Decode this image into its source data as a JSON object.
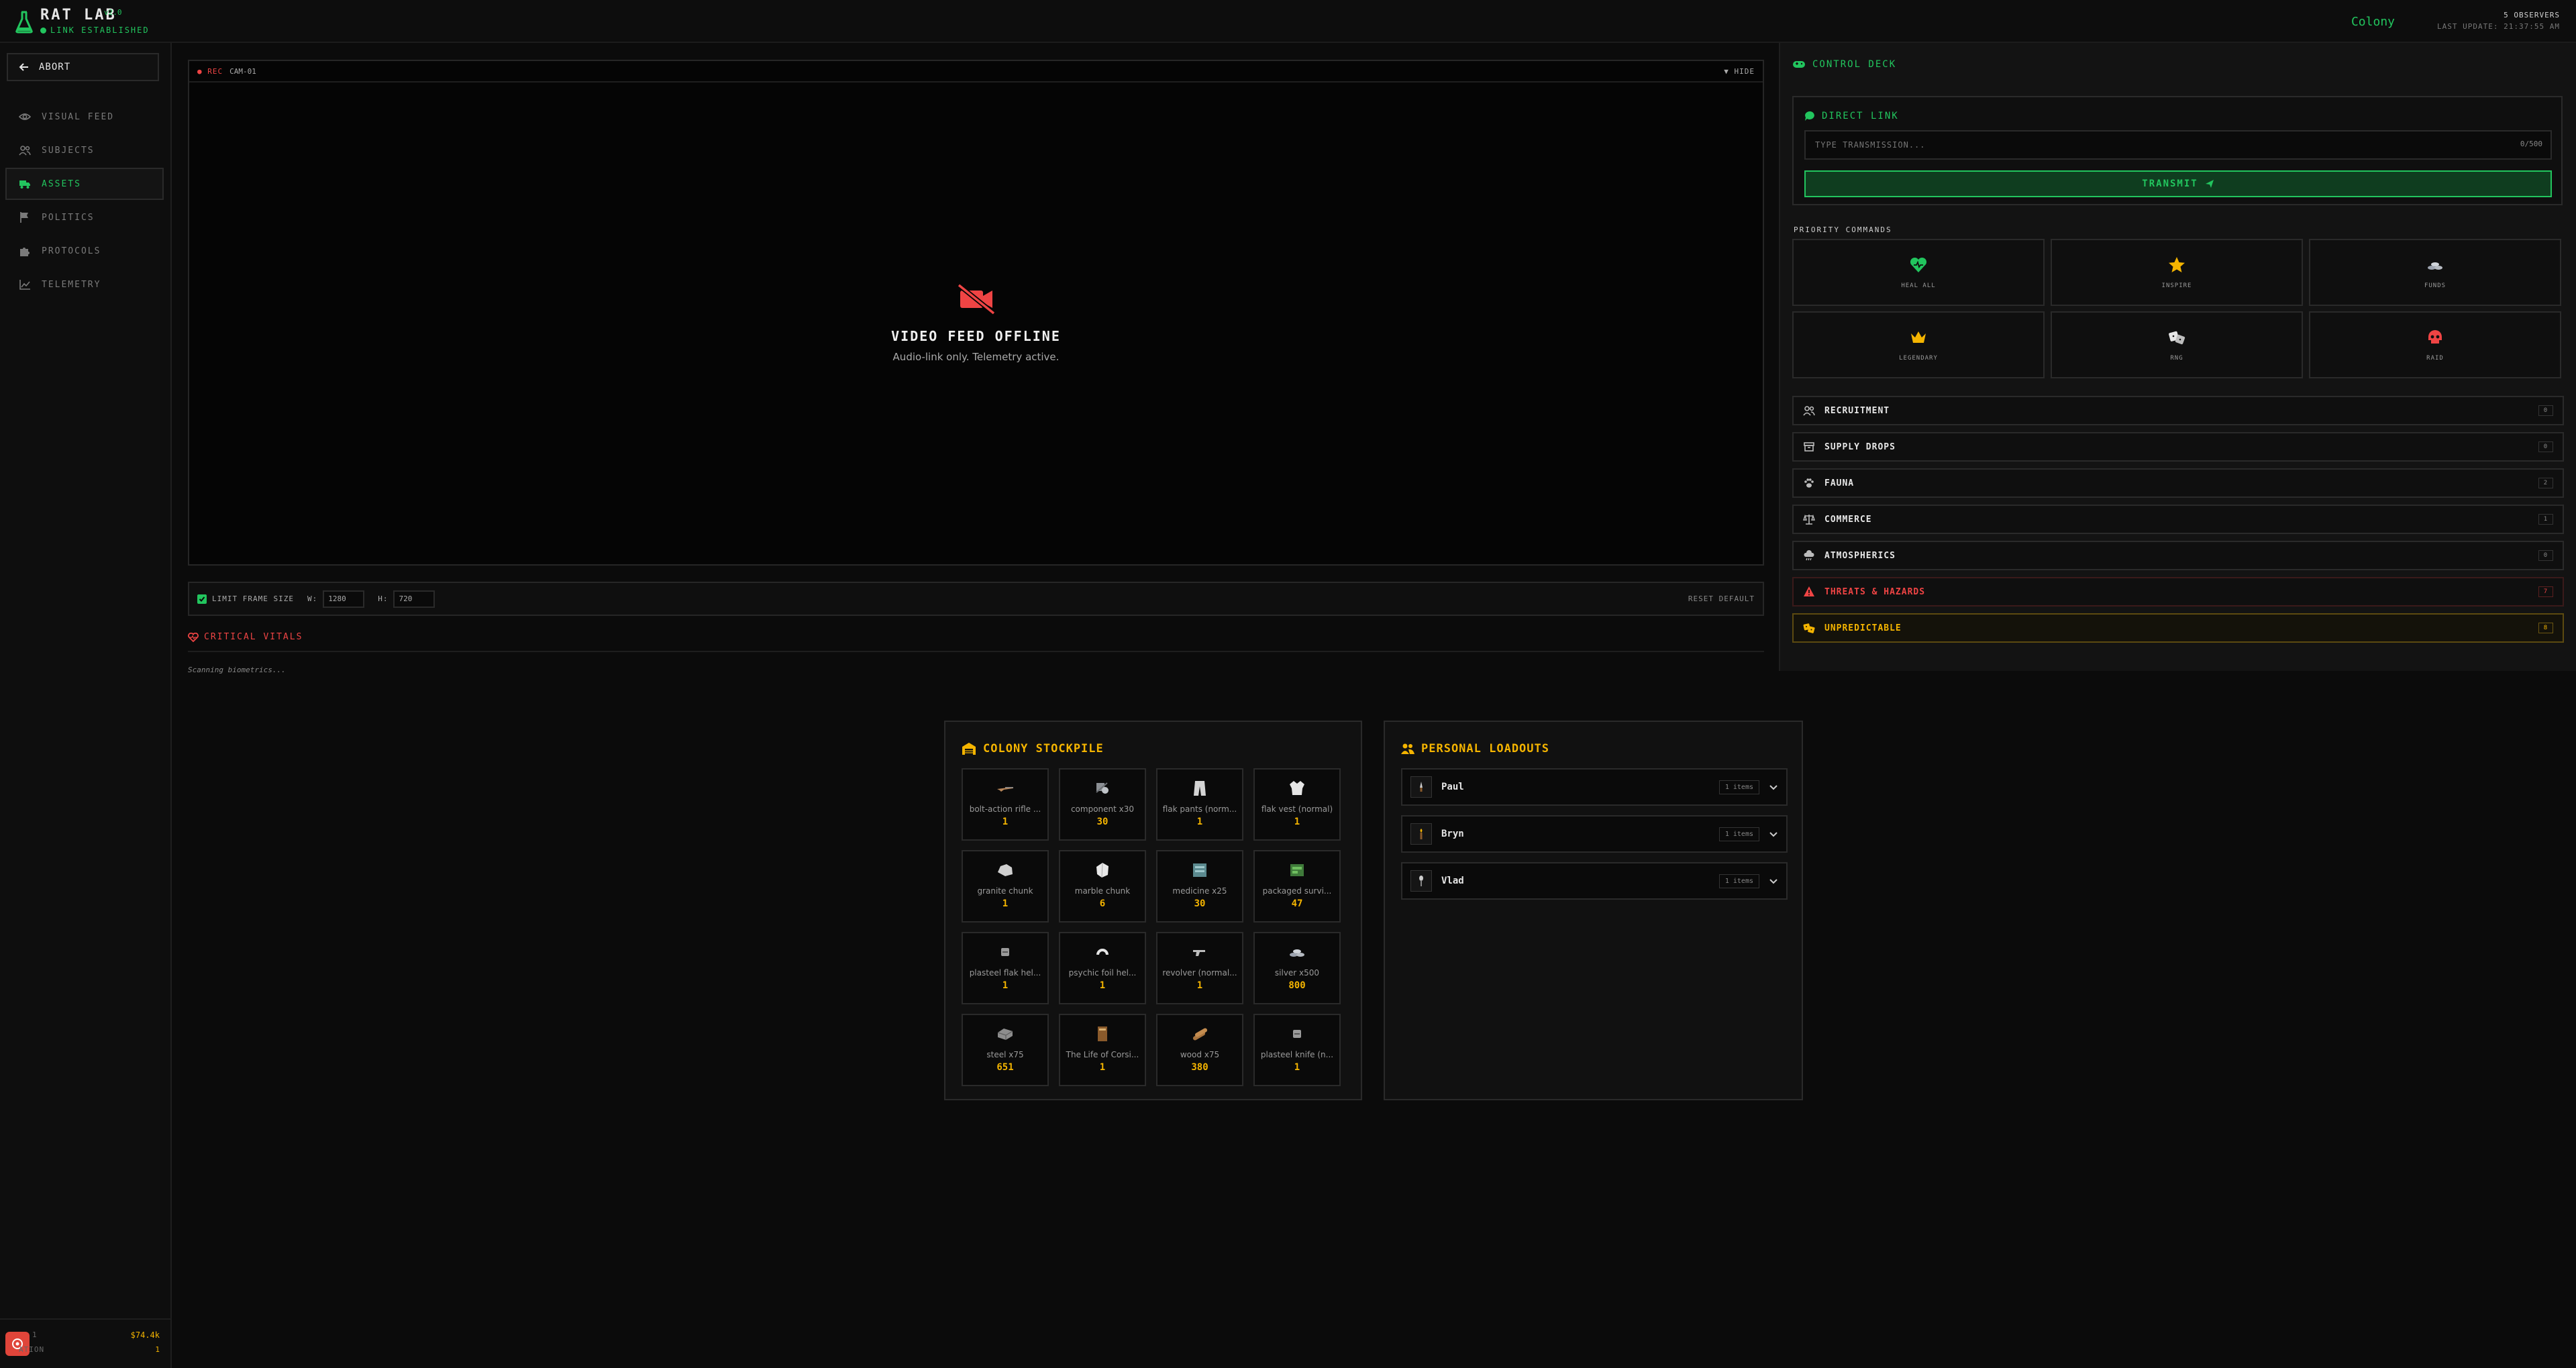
{
  "header": {
    "title": "RAT LAB",
    "version": "v2.0",
    "link_status": "LINK ESTABLISHED",
    "colony": "Colony",
    "observers": "5 OBSERVERS",
    "last_update": "LAST UPDATE: 21:37:55 AM"
  },
  "sidebar": {
    "abort_label": "ABORT",
    "items": [
      {
        "label": "VISUAL FEED",
        "icon": "eye-icon"
      },
      {
        "label": "SUBJECTS",
        "icon": "users-icon"
      },
      {
        "label": "ASSETS",
        "icon": "truck-icon",
        "active": true
      },
      {
        "label": "POLITICS",
        "icon": "flag-icon"
      },
      {
        "label": "PROTOCOLS",
        "icon": "puzzle-icon"
      },
      {
        "label": "TELEMETRY",
        "icon": "chart-icon"
      }
    ],
    "footer": {
      "left_top": "1",
      "money": "$74.4k",
      "left_bottom": "ATION",
      "count": "1"
    }
  },
  "video": {
    "rec_label": "● REC",
    "cam_label": "CAM-01",
    "hide_label": "▼ HIDE",
    "offline_title": "VIDEO FEED OFFLINE",
    "offline_sub": "Audio-link only. Telemetry active."
  },
  "frame": {
    "limit_label": "LIMIT FRAME SIZE",
    "w_label": "W:",
    "w_value": "1280",
    "h_label": "H:",
    "h_value": "720",
    "reset_label": "RESET DEFAULT"
  },
  "vitals": {
    "title": "CRITICAL VITALS",
    "scan_text": "Scanning biometrics..."
  },
  "deck": {
    "title": "CONTROL DECK",
    "direct_title": "DIRECT LINK",
    "input_placeholder": "TYPE TRANSMISSION...",
    "input_count": "0/500",
    "transmit_label": "TRANSMIT",
    "priority_label": "PRIORITY COMMANDS",
    "priority": [
      {
        "label": "HEAL ALL",
        "icon": "heart-icon",
        "color": "#22c55e"
      },
      {
        "label": "INSPIRE",
        "icon": "star-icon",
        "color": "#f4b400"
      },
      {
        "label": "FUNDS",
        "icon": "coins-icon",
        "color": "#9ca3af"
      },
      {
        "label": "LEGENDARY",
        "icon": "crown-icon",
        "color": "#f4b400"
      },
      {
        "label": "RNG",
        "icon": "dice-icon",
        "color": "#e5e5e5"
      },
      {
        "label": "RAID",
        "icon": "skull-icon",
        "color": "#ef4444"
      }
    ],
    "categories": [
      {
        "label": "RECRUITMENT",
        "count": "0",
        "icon": "users-icon",
        "kind": "normal"
      },
      {
        "label": "SUPPLY DROPS",
        "count": "0",
        "icon": "box-icon",
        "kind": "normal"
      },
      {
        "label": "FAUNA",
        "count": "2",
        "icon": "paw-icon",
        "kind": "normal"
      },
      {
        "label": "COMMERCE",
        "count": "1",
        "icon": "scale-icon",
        "kind": "normal"
      },
      {
        "label": "ATMOSPHERICS",
        "count": "0",
        "icon": "cloud-icon",
        "kind": "normal"
      },
      {
        "label": "THREATS & HAZARDS",
        "count": "7",
        "icon": "warning-icon",
        "kind": "threat"
      },
      {
        "label": "UNPREDICTABLE",
        "count": "8",
        "icon": "dice-icon",
        "kind": "unpred"
      }
    ]
  },
  "stockpile": {
    "title": "COLONY STOCKPILE",
    "items": [
      {
        "name": "bolt-action rifle ...",
        "qty": "1",
        "icon": "rifle-icon"
      },
      {
        "name": "component x30",
        "qty": "30",
        "icon": "component-icon"
      },
      {
        "name": "flak pants (norm...",
        "qty": "1",
        "icon": "pants-icon"
      },
      {
        "name": "flak vest (normal)",
        "qty": "1",
        "icon": "vest-icon"
      },
      {
        "name": "granite chunk",
        "qty": "1",
        "icon": "rock-icon"
      },
      {
        "name": "marble chunk",
        "qty": "6",
        "icon": "marble-icon"
      },
      {
        "name": "medicine x25",
        "qty": "30",
        "icon": "medicine-icon"
      },
      {
        "name": "packaged survi...",
        "qty": "47",
        "icon": "meal-icon"
      },
      {
        "name": "plasteel flak hel...",
        "qty": "1",
        "icon": "helmet-icon"
      },
      {
        "name": "psychic foil hel...",
        "qty": "1",
        "icon": "foil-helmet-icon"
      },
      {
        "name": "revolver (normal...",
        "qty": "1",
        "icon": "revolver-icon"
      },
      {
        "name": "silver x500",
        "qty": "800",
        "icon": "silver-icon"
      },
      {
        "name": "steel x75",
        "qty": "651",
        "icon": "steel-icon"
      },
      {
        "name": "The Life of Corsi...",
        "qty": "1",
        "icon": "book-icon"
      },
      {
        "name": "wood x75",
        "qty": "380",
        "icon": "wood-icon"
      },
      {
        "name": "plasteel knife (n...",
        "qty": "1",
        "icon": "knife-icon"
      }
    ]
  },
  "loadouts": {
    "title": "PERSONAL LOADOUTS",
    "rows": [
      {
        "name": "Paul",
        "items": "1 items"
      },
      {
        "name": "Bryn",
        "items": "1 items"
      },
      {
        "name": "Vlad",
        "items": "1 items"
      }
    ]
  }
}
